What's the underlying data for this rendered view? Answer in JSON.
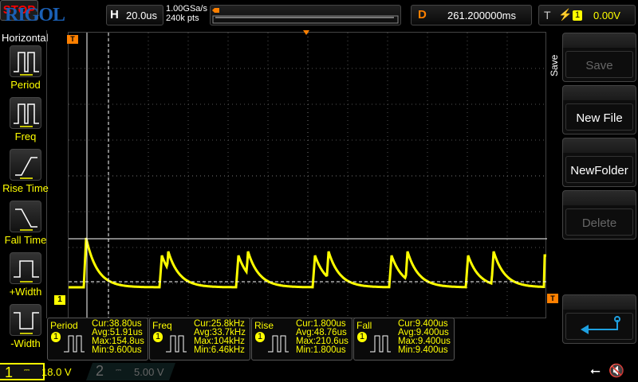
{
  "header": {
    "logo": "RIGOL",
    "run_state": "STOP",
    "timebase_label": "H",
    "timebase": "20.0us",
    "sample_rate": "1.00GSa/s",
    "memory_depth": "240k pts",
    "delay_label": "D",
    "delay": "261.200000ms",
    "trigger_label": "T",
    "trigger_source": "1",
    "trigger_level": "0.00V"
  },
  "left_panel": {
    "title": "Horizontal",
    "items": [
      {
        "label": "Period",
        "icon": "period-icon"
      },
      {
        "label": "Freq",
        "icon": "freq-icon"
      },
      {
        "label": "Rise Time",
        "icon": "rise-time-icon"
      },
      {
        "label": "Fall Time",
        "icon": "fall-time-icon"
      },
      {
        "label": "+Width",
        "icon": "plus-width-icon"
      },
      {
        "label": "-Width",
        "icon": "minus-width-icon"
      }
    ]
  },
  "right_panel": {
    "title": "Save",
    "buttons": [
      {
        "label": "Save",
        "enabled": false
      },
      {
        "label": "New File",
        "enabled": true
      },
      {
        "label": "NewFolder",
        "enabled": true
      },
      {
        "label": "Delete",
        "enabled": false
      }
    ],
    "back_icon": "return-arrow-icon"
  },
  "markers": {
    "trigger": "T",
    "channel1": "1"
  },
  "measurements": [
    {
      "name": "Period",
      "source": "1",
      "cur": "Cur:38.80us",
      "avg": "Avg:51.91us",
      "max": "Max:154.8us",
      "min": "Min:9.600us"
    },
    {
      "name": "Freq",
      "source": "1",
      "cur": "Cur:25.8kHz",
      "avg": "Avg:33.7kHz",
      "max": "Max:104kHz",
      "min": "Min:6.46kHz"
    },
    {
      "name": "Rise",
      "source": "1",
      "cur": "Cur:1.800us",
      "avg": "Avg:48.76us",
      "max": "Max:210.6us",
      "min": "Min:1.800us"
    },
    {
      "name": "Fall",
      "source": "1",
      "cur": "Cur:9.400us",
      "avg": "Avg:9.400us",
      "max": "Max:9.400us",
      "min": "Min:9.400us"
    }
  ],
  "channels": [
    {
      "num": "1",
      "scale": "18.0 V",
      "color": "#ffff00",
      "active": true
    },
    {
      "num": "2",
      "scale": "5.00 V",
      "color": "#00c0c0",
      "active": false
    }
  ],
  "status": {
    "usb_icon": "usb-icon",
    "mute_icon": "speaker-mute-icon"
  },
  "colors": {
    "ch1": "#ffff00",
    "trigger": "#ff8000",
    "accent": "#1a5fb4",
    "back": "#1ea0e0"
  }
}
